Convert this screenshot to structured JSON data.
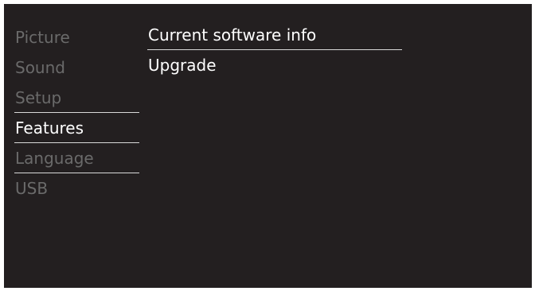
{
  "left_menu": {
    "items": [
      {
        "label": "Picture"
      },
      {
        "label": "Sound"
      },
      {
        "label": "Setup"
      },
      {
        "label": "Features"
      },
      {
        "label": "Language"
      },
      {
        "label": "USB"
      }
    ],
    "selected": "Features"
  },
  "right_menu": {
    "items": [
      {
        "label": "Current software info"
      },
      {
        "label": "Upgrade"
      }
    ],
    "focused": "Current software info"
  },
  "colors": {
    "background": "#231f20",
    "text_active": "#ffffff",
    "text_inactive": "#6a6a6a",
    "divider": "#d9d9d9"
  }
}
